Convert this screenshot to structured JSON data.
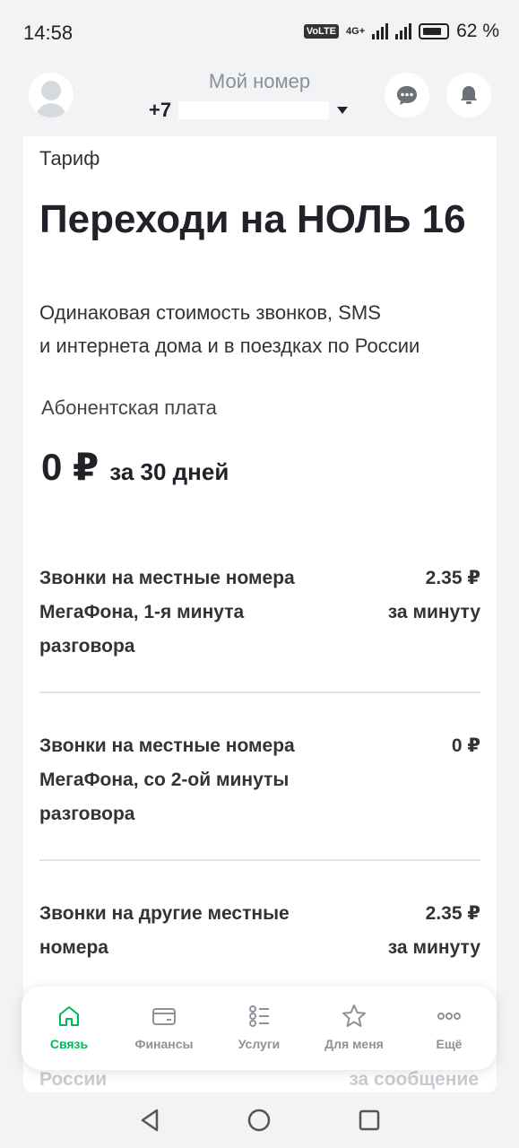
{
  "status_bar": {
    "time": "14:58",
    "volte": "VoLTE",
    "network": "4G+",
    "battery": "62 %"
  },
  "header": {
    "title": "Мой номер",
    "phone_prefix": "+7"
  },
  "tariff": {
    "label": "Тариф",
    "name": "Переходи на НОЛЬ 16",
    "description_line1": "Одинаковая стоимость звонков, SMS",
    "description_line2": "и интернета дома и в поездках по России",
    "fee_label": "Абонентская плата",
    "fee_value": "0 ₽",
    "fee_period": "за 30 дней"
  },
  "rates": [
    {
      "name": "Звонки на местные номера МегаФона, 1-я минута разговора",
      "price": "2.35 ₽",
      "unit": "за минуту"
    },
    {
      "name": "Звонки на местные номера МегаФона, со 2-ой минуты разговора",
      "price": "0 ₽",
      "unit": ""
    },
    {
      "name": "Звонки на другие местные номера",
      "price": "2.35 ₽",
      "unit": "за минуту"
    }
  ],
  "peek": {
    "left": "России",
    "right": "за сообщение"
  },
  "bottom_nav": [
    {
      "label": "Связь",
      "icon": "home-icon",
      "active": true
    },
    {
      "label": "Финансы",
      "icon": "wallet-icon",
      "active": false
    },
    {
      "label": "Услуги",
      "icon": "services-list-icon",
      "active": false
    },
    {
      "label": "Для меня",
      "icon": "star-icon",
      "active": false
    },
    {
      "label": "Ещё",
      "icon": "more-dots-icon",
      "active": false
    }
  ],
  "colors": {
    "accent": "#00b956",
    "background": "#f2f3f5",
    "text": "#1f2229"
  }
}
